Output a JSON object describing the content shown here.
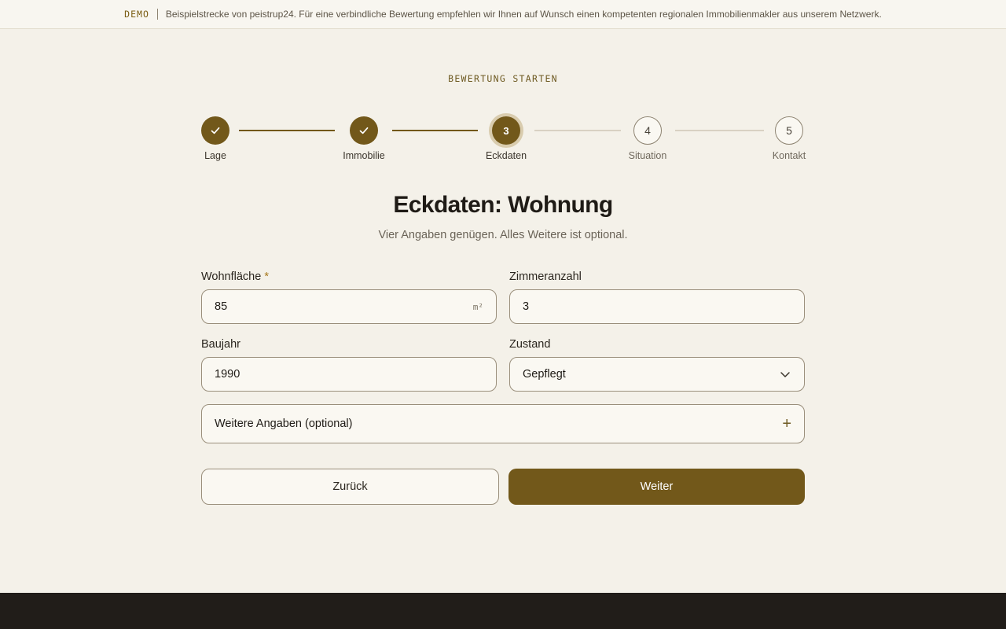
{
  "banner": {
    "tag": "DEMO",
    "text": "Beispielstrecke von peistrup24. Für eine verbindliche Bewertung empfehlen wir Ihnen auf Wunsch einen kompetenten regionalen Immobilienmakler aus unserem Netzwerk."
  },
  "eyebrow": "BEWERTUNG STARTEN",
  "steps": [
    {
      "label": "Lage",
      "state": "done",
      "icon": "check-icon"
    },
    {
      "label": "Immobilie",
      "state": "done",
      "icon": "check-icon"
    },
    {
      "number": "3",
      "label": "Eckdaten",
      "state": "active"
    },
    {
      "number": "4",
      "label": "Situation",
      "state": "todo"
    },
    {
      "number": "5",
      "label": "Kontakt",
      "state": "todo"
    }
  ],
  "form": {
    "title": "Eckdaten: Wohnung",
    "subtitle": "Vier Angaben genügen. Alles Weitere ist optional.",
    "wohnflaeche": {
      "label": "Wohnfläche",
      "required_mark": "*",
      "value": "85",
      "unit": "m²"
    },
    "zimmer": {
      "label": "Zimmeranzahl",
      "value": "3"
    },
    "baujahr": {
      "label": "Baujahr",
      "value": "1990"
    },
    "zustand": {
      "label": "Zustand",
      "value": "Gepflegt",
      "icon": "chevron-down-icon"
    },
    "weitere": {
      "label": "Weitere Angaben (optional)",
      "icon": "plus-icon"
    }
  },
  "buttons": {
    "back": "Zurück",
    "next": "Weiter"
  },
  "colors": {
    "accent": "#72581a",
    "background": "#f4f1e9",
    "footer": "#211d19"
  }
}
